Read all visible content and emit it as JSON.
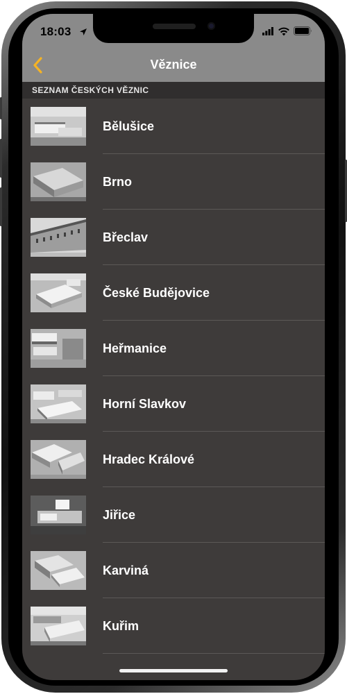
{
  "status_bar": {
    "time": "18:03"
  },
  "nav": {
    "title": "Věznice",
    "accent_color": "#f5b324"
  },
  "section": {
    "header": "SEZNAM ČESKÝCH VĚZNIC"
  },
  "prisons": [
    {
      "name": "Bělušice"
    },
    {
      "name": "Brno"
    },
    {
      "name": "Břeclav"
    },
    {
      "name": "České Budějovice"
    },
    {
      "name": "Heřmanice"
    },
    {
      "name": "Horní Slavkov"
    },
    {
      "name": "Hradec Králové"
    },
    {
      "name": "Jiřice"
    },
    {
      "name": "Karviná"
    },
    {
      "name": "Kuřim"
    }
  ]
}
